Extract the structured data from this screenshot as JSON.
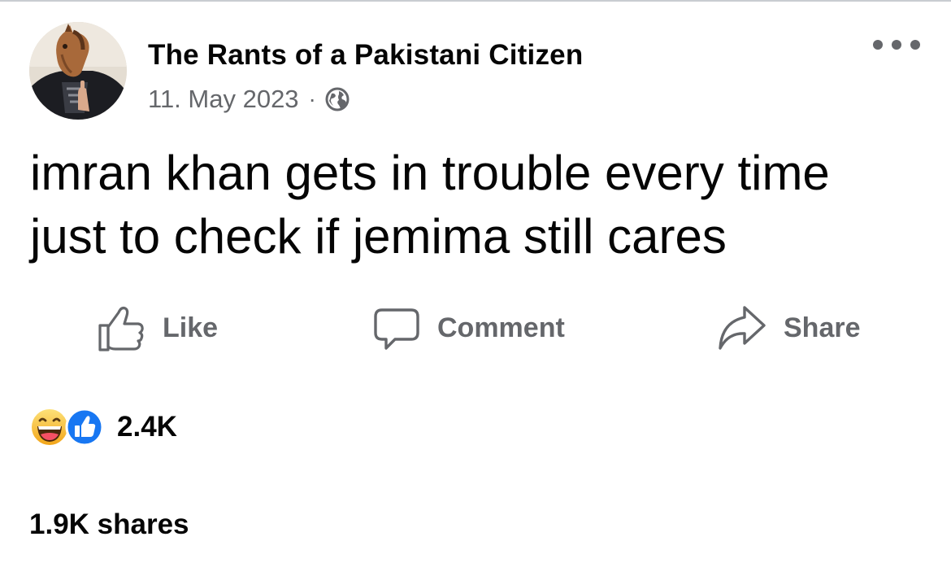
{
  "post": {
    "page_name": "The Rants of a Pakistani Citizen",
    "date": "11. May 2023",
    "separator": "·",
    "privacy_icon": "globe-icon",
    "text_lines": [
      "imran khan gets in trouble every time",
      "just to check if jemima still cares"
    ]
  },
  "actions": {
    "like_label": "Like",
    "comment_label": "Comment",
    "share_label": "Share"
  },
  "stats": {
    "reaction_icons": [
      "haha-reaction-icon",
      "like-reaction-icon"
    ],
    "reactions_count": "2.4K",
    "shares_text": "1.9K shares"
  },
  "colors": {
    "text_primary": "#050505",
    "text_secondary": "#65676b",
    "like_blue": "#1877f2",
    "haha_yellow": "#f7b928",
    "divider": "#c9ccd1"
  }
}
